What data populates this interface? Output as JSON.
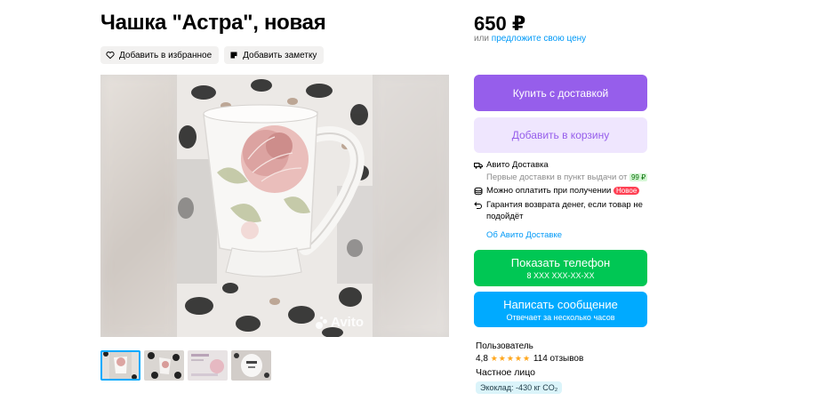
{
  "listing": {
    "title": "Чашка \"Астра\", новая",
    "favorite_label": "Добавить в избранное",
    "note_label": "Добавить заметку",
    "watermark": "Avito"
  },
  "price": {
    "value": "650 ₽",
    "or": "или",
    "offer_link": "предложите свою цену"
  },
  "buttons": {
    "buy": "Купить с доставкой",
    "cart": "Добавить в корзину",
    "phone": "Показать телефон",
    "phone_masked": "8 XXX XXX-XX-XX",
    "message": "Написать сообщение",
    "message_sub": "Отвечает за несколько часов"
  },
  "delivery": {
    "title": "Авито Доставка",
    "first_text": "Первые доставки в пункт выдачи от",
    "first_price": "99 ₽",
    "pay_text": "Можно оплатить при получении",
    "new_badge": "Новое",
    "guarantee": "Гарантия возврата денег, если товар не подойдёт",
    "about_link": "Об Авито Доставке"
  },
  "seller": {
    "name": "Пользователь",
    "rating": "4,8",
    "stars": "★★★★★",
    "reviews": "114 отзывов",
    "type": "Частное лицо",
    "eco": "Экоклад: -430 кг CO₂"
  },
  "icons": {
    "favorite": "heart-icon",
    "note": "note-icon",
    "delivery": "truck-icon",
    "payment": "coins-icon",
    "guarantee": "return-arrow-icon"
  },
  "colors": {
    "buy": "#965eeb",
    "cart_bg": "#efe6fe",
    "phone": "#00c754",
    "message": "#00aaff",
    "link": "#0099f7"
  }
}
